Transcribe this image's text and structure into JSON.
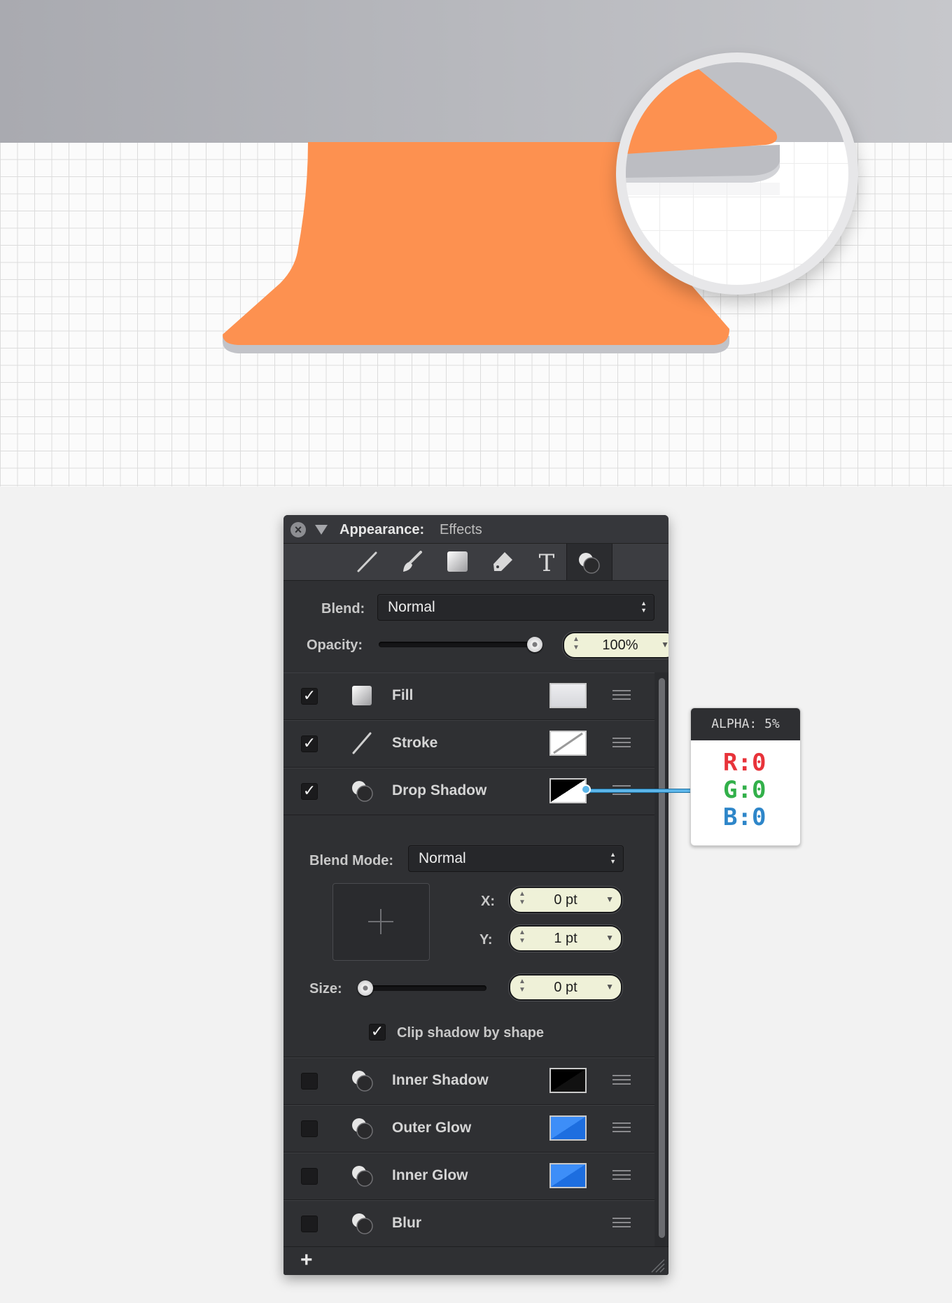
{
  "panel": {
    "title": "Appearance:",
    "subtitle": "Effects",
    "close_icon": "×",
    "blend_label": "Blend:",
    "blend_value": "Normal",
    "opacity_label": "Opacity:",
    "opacity_value": "100%",
    "opacity_level": 1.0,
    "effects": [
      {
        "label": "Fill",
        "checked": true,
        "icon": "fill-icon"
      },
      {
        "label": "Stroke",
        "checked": true,
        "icon": "stroke-icon"
      },
      {
        "label": "Drop Shadow",
        "checked": true,
        "icon": "effect-icon"
      },
      {
        "label": "Inner Shadow",
        "checked": false,
        "icon": "effect-icon"
      },
      {
        "label": "Outer Glow",
        "checked": false,
        "icon": "effect-icon"
      },
      {
        "label": "Inner Glow",
        "checked": false,
        "icon": "effect-icon"
      },
      {
        "label": "Blur",
        "checked": false,
        "icon": "effect-icon"
      }
    ],
    "drop_shadow": {
      "blend_mode_label": "Blend Mode:",
      "blend_mode_value": "Normal",
      "x_label": "X:",
      "x_value": "0 pt",
      "y_label": "Y:",
      "y_value": "1 pt",
      "size_label": "Size:",
      "size_value": "0 pt",
      "size_level": 0,
      "clip_label": "Clip shadow by shape",
      "clip_checked": true
    },
    "add_label": "+"
  },
  "callout": {
    "alpha_label": "ALPHA: 5%",
    "r": "R:0",
    "g": "G:0",
    "b": "B:0"
  },
  "colors": {
    "orange": "#fd9150",
    "panel_bg": "#2f3033",
    "stepper_bg": "#eff1d8",
    "accent_blue": "#3d8ef8",
    "r": "#e8333a",
    "g": "#32b04a",
    "b": "#2e86c9"
  },
  "icons": [
    "line-tool-icon",
    "brush-icon",
    "square-fill-icon",
    "pen-icon",
    "text-tool-icon",
    "effects-icon",
    "grip-icon",
    "resize-grip-icon"
  ]
}
